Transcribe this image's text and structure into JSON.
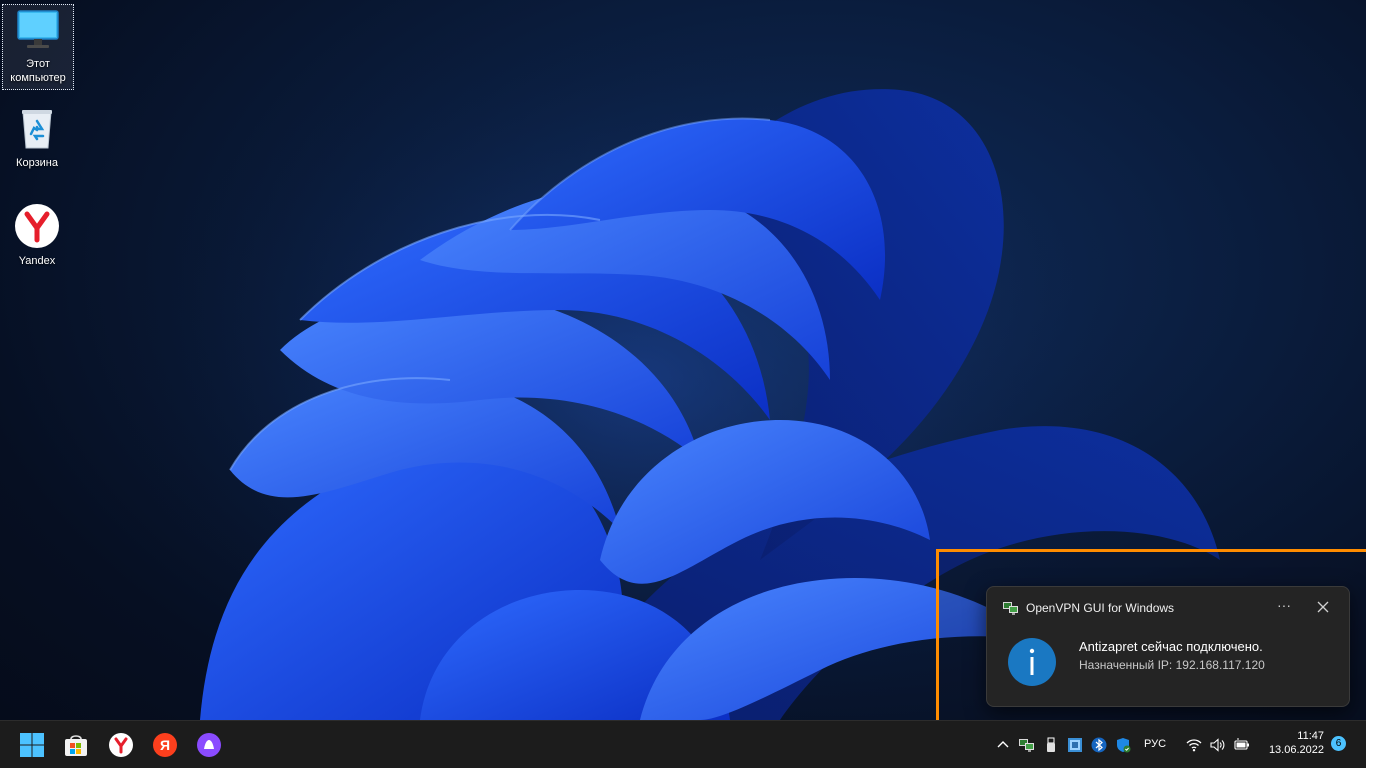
{
  "desktop": {
    "icons": [
      {
        "label_line1": "Этот",
        "label_line2": "компьютер",
        "icon": "monitor-icon"
      },
      {
        "label": "Корзина",
        "icon": "recycle-bin-icon"
      },
      {
        "label": "Yandex",
        "icon": "yandex-browser-icon"
      }
    ]
  },
  "notification": {
    "app_name": "OpenVPN GUI for Windows",
    "more_label": "···",
    "title": "Antizapret сейчас подключено.",
    "body": "Назначенный IP: 192.168.117.120",
    "icon": "info-icon",
    "highlight_color": "#ff8c00"
  },
  "taskbar": {
    "pinned": [
      "windows-start-icon",
      "microsoft-store-icon",
      "yandex-browser-icon",
      "yandex-icon",
      "alice-icon"
    ],
    "tray": {
      "language": "РУС",
      "time": "11:47",
      "date": "13.06.2022",
      "notification_count": "6"
    }
  },
  "colors": {
    "taskbar_bg": "#1c1c1c",
    "toast_bg": "#242424",
    "accent": "#4cc2ff",
    "info_blue": "#1a78c2"
  }
}
